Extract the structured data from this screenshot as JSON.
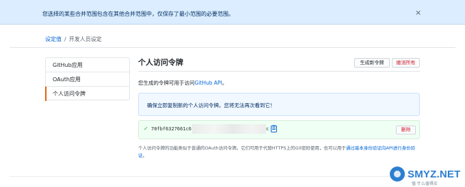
{
  "flash": {
    "message": "您选择的某些合并范围包含在其他合并范围中，仅保存了最小范围的必要范围。",
    "close": "×"
  },
  "breadcrumb": {
    "root": "设定值",
    "separator": "/",
    "current": "开发人员设定"
  },
  "sidebar": {
    "items": [
      {
        "label": "GitHub应用"
      },
      {
        "label": "OAuth应用"
      },
      {
        "label": "个人访问令牌"
      }
    ]
  },
  "main": {
    "title": "个人访问令牌",
    "generate_button": "生成新令牌",
    "revoke_all_button": "撤消所有",
    "description_prefix": "您生成的令牌可用于访问",
    "description_link": "GitHub API",
    "description_suffix": "。",
    "notice": "确保立即复制新的个人访问令牌。您将无法再次看到它！",
    "token": {
      "check": "✓",
      "prefix": "70fbf6327661c6",
      "suffix": "c",
      "delete_button": "删除"
    },
    "footer_note_prefix": "个人访问令牌的功能类似于普通的OAuth访问令牌。它们可用于代替HTTPS上的Git密码使用，也可以用于",
    "footer_note_link": "通过基本身份验证向API进行身份验证",
    "footer_note_suffix": "。"
  },
  "watermark": {
    "text": "SMYZ.NET",
    "sub": "值 什么值得买"
  },
  "colors": {
    "accent": "#0366d6",
    "danger": "#cb2431",
    "selected_marker": "#e36209",
    "success": "#28a745"
  },
  "icons": [
    "close-icon",
    "check-icon",
    "clipboard-icon"
  ]
}
